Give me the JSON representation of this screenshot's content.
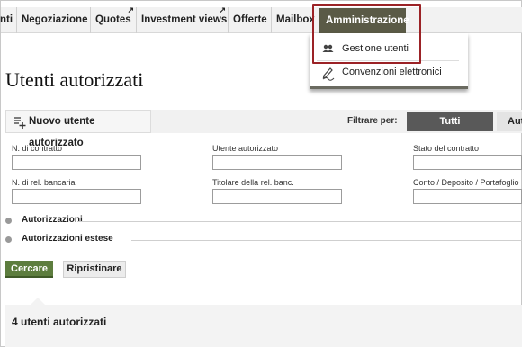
{
  "nav": {
    "items": [
      {
        "label": "nti",
        "external": false
      },
      {
        "label": "Negoziazione",
        "external": false
      },
      {
        "label": "Quotes",
        "external": true
      },
      {
        "label": "Investment views",
        "external": true
      },
      {
        "label": "Offerte",
        "external": false
      },
      {
        "label": "Mailbox",
        "external": false
      }
    ],
    "active": "Amministrazione",
    "external_glyph": "↗"
  },
  "dropdown": {
    "items": [
      {
        "label": "Gestione utenti",
        "icon": "users-icon"
      },
      {
        "label": "Convenzioni elettronici",
        "icon": "pen-sign-icon"
      }
    ]
  },
  "page": {
    "title": "Utenti autorizzati"
  },
  "toolbar": {
    "new_button": "Nuovo utente autorizzato",
    "filter_label": "Filtrare per:",
    "filter_all": "Tutti",
    "filter_next": "Aut"
  },
  "form": {
    "contract_no": "N. di contratto",
    "authorized_user": "Utente autorizzato",
    "contract_status": "Stato del contratto",
    "bank_rel_no": "N. di rel. bancaria",
    "bank_rel_holder": "Titolare della rel. banc.",
    "account": "Conto / Deposito / Portafoglio"
  },
  "sections": {
    "authorizations": "Autorizzazioni",
    "extended": "Autorizzazioni estese"
  },
  "buttons": {
    "search": "Cercare",
    "reset": "Ripristinare"
  },
  "results": {
    "title": "4 utenti autorizzati"
  },
  "colors": {
    "active_nav": "#5a5a46",
    "highlight": "#9b2226",
    "search_button": "#5d7d3e",
    "filter_active": "#595959"
  }
}
